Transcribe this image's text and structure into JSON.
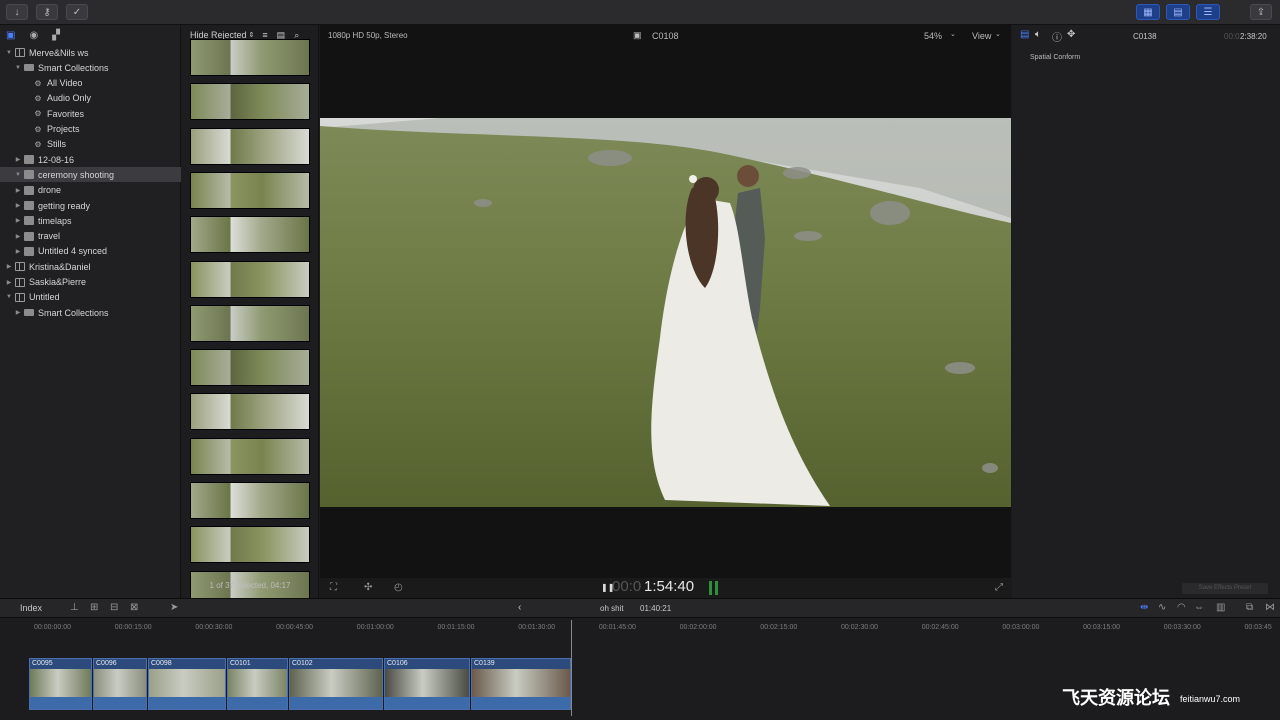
{
  "sidebar": {
    "items": [
      {
        "label": "Merve&Nils ws",
        "icon": "library-icon",
        "depth": 0,
        "expanded": true
      },
      {
        "label": "Smart Collections",
        "icon": "folder-icon",
        "depth": 1,
        "expanded": true
      },
      {
        "label": "All Video",
        "icon": "gear-icon",
        "depth": 2
      },
      {
        "label": "Audio Only",
        "icon": "gear-icon",
        "depth": 2
      },
      {
        "label": "Favorites",
        "icon": "gear-icon",
        "depth": 2
      },
      {
        "label": "Projects",
        "icon": "gear-icon",
        "depth": 2
      },
      {
        "label": "Stills",
        "icon": "gear-icon",
        "depth": 2
      },
      {
        "label": "12-08-16",
        "icon": "event-icon",
        "depth": 1,
        "expanded": false
      },
      {
        "label": "ceremony shooting",
        "icon": "event-icon",
        "depth": 1,
        "expanded": true,
        "selected": true
      },
      {
        "label": "drone",
        "icon": "event-icon",
        "depth": 1,
        "expanded": false
      },
      {
        "label": "getting ready",
        "icon": "event-icon",
        "depth": 1,
        "expanded": false
      },
      {
        "label": "timelaps",
        "icon": "event-icon",
        "depth": 1,
        "expanded": false
      },
      {
        "label": "travel",
        "icon": "event-icon",
        "depth": 1,
        "expanded": false
      },
      {
        "label": "Untitled 4 synced",
        "icon": "event-icon",
        "depth": 1,
        "expanded": false
      },
      {
        "label": "Kristina&Daniel",
        "icon": "library-icon",
        "depth": 0,
        "expanded": false
      },
      {
        "label": "Saskia&Pierre",
        "icon": "library-icon",
        "depth": 0,
        "expanded": false
      },
      {
        "label": "Untitled",
        "icon": "library-icon",
        "depth": 0,
        "expanded": true
      },
      {
        "label": "Smart Collections",
        "icon": "folder-icon",
        "depth": 1,
        "expanded": false
      }
    ]
  },
  "browser": {
    "filter_label": "Hide Rejected",
    "status": "1 of 37 selected, 04:17",
    "clip_count_visible": 13
  },
  "viewer": {
    "format": "1080p HD 50p, Stereo",
    "clip_name": "C0108",
    "zoom": "54%",
    "view_label": "View",
    "timecode_dim": "00:0",
    "timecode": "1:54:40"
  },
  "inspector": {
    "clip_name": "C0138",
    "duration_dim": "00:0",
    "duration": "2:38:20",
    "section": "Spatial Conform",
    "save_preset": "Save Effects Preset"
  },
  "timeline": {
    "index_label": "Index",
    "project_name": "oh shit",
    "project_duration": "01:40:21",
    "ruler": [
      "00:00:00:00",
      "00:00:15:00",
      "00:00:30:00",
      "00:00:45:00",
      "00:01:00:00",
      "00:01:15:00",
      "00:01:30:00",
      "00:01:45:00",
      "00:02:00:00",
      "00:02:15:00",
      "00:02:30:00",
      "00:02:45:00",
      "00:03:00:00",
      "00:03:15:00",
      "00:03:30:00",
      "00:03:45"
    ],
    "clips": [
      {
        "name": "C0095"
      },
      {
        "name": "C0096"
      },
      {
        "name": "C0098"
      },
      {
        "name": "C0101"
      },
      {
        "name": "C0102"
      },
      {
        "name": "C0106"
      },
      {
        "name": "C0139"
      }
    ]
  },
  "watermark": {
    "brand": "飞天资源论坛",
    "site": "feitianwu7.com"
  },
  "colors": {
    "accent": "#2d58b8",
    "selection": "#3b3b40",
    "clip": "#2c4a7c"
  }
}
